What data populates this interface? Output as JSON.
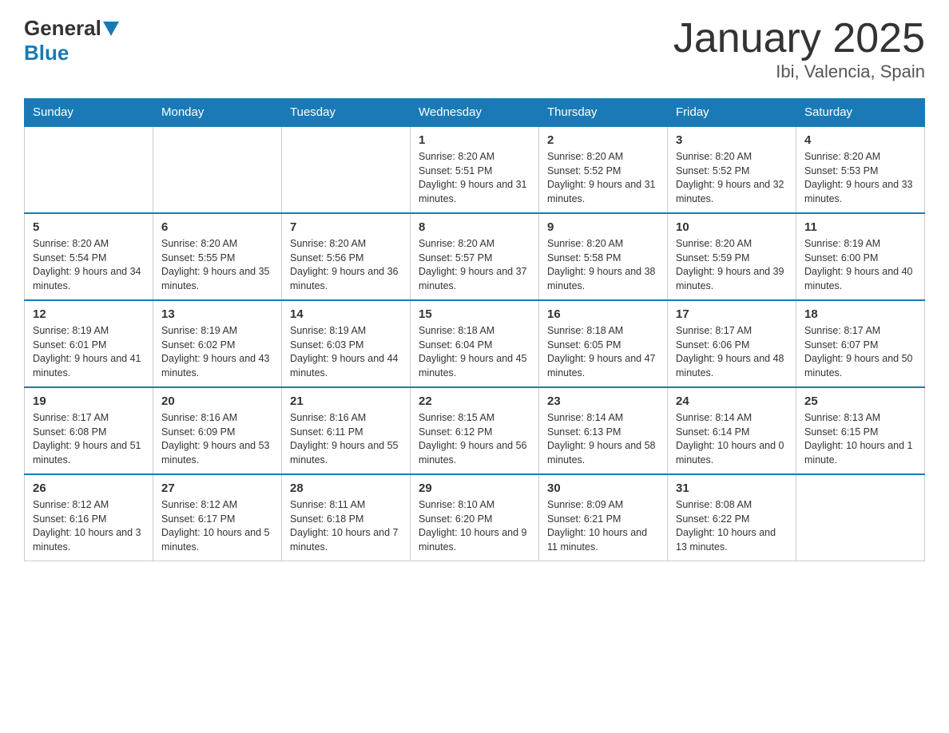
{
  "logo": {
    "general": "General",
    "blue": "Blue"
  },
  "title": "January 2025",
  "subtitle": "Ibi, Valencia, Spain",
  "days_of_week": [
    "Sunday",
    "Monday",
    "Tuesday",
    "Wednesday",
    "Thursday",
    "Friday",
    "Saturday"
  ],
  "weeks": [
    [
      {
        "num": "",
        "info": ""
      },
      {
        "num": "",
        "info": ""
      },
      {
        "num": "",
        "info": ""
      },
      {
        "num": "1",
        "info": "Sunrise: 8:20 AM\nSunset: 5:51 PM\nDaylight: 9 hours and 31 minutes."
      },
      {
        "num": "2",
        "info": "Sunrise: 8:20 AM\nSunset: 5:52 PM\nDaylight: 9 hours and 31 minutes."
      },
      {
        "num": "3",
        "info": "Sunrise: 8:20 AM\nSunset: 5:52 PM\nDaylight: 9 hours and 32 minutes."
      },
      {
        "num": "4",
        "info": "Sunrise: 8:20 AM\nSunset: 5:53 PM\nDaylight: 9 hours and 33 minutes."
      }
    ],
    [
      {
        "num": "5",
        "info": "Sunrise: 8:20 AM\nSunset: 5:54 PM\nDaylight: 9 hours and 34 minutes."
      },
      {
        "num": "6",
        "info": "Sunrise: 8:20 AM\nSunset: 5:55 PM\nDaylight: 9 hours and 35 minutes."
      },
      {
        "num": "7",
        "info": "Sunrise: 8:20 AM\nSunset: 5:56 PM\nDaylight: 9 hours and 36 minutes."
      },
      {
        "num": "8",
        "info": "Sunrise: 8:20 AM\nSunset: 5:57 PM\nDaylight: 9 hours and 37 minutes."
      },
      {
        "num": "9",
        "info": "Sunrise: 8:20 AM\nSunset: 5:58 PM\nDaylight: 9 hours and 38 minutes."
      },
      {
        "num": "10",
        "info": "Sunrise: 8:20 AM\nSunset: 5:59 PM\nDaylight: 9 hours and 39 minutes."
      },
      {
        "num": "11",
        "info": "Sunrise: 8:19 AM\nSunset: 6:00 PM\nDaylight: 9 hours and 40 minutes."
      }
    ],
    [
      {
        "num": "12",
        "info": "Sunrise: 8:19 AM\nSunset: 6:01 PM\nDaylight: 9 hours and 41 minutes."
      },
      {
        "num": "13",
        "info": "Sunrise: 8:19 AM\nSunset: 6:02 PM\nDaylight: 9 hours and 43 minutes."
      },
      {
        "num": "14",
        "info": "Sunrise: 8:19 AM\nSunset: 6:03 PM\nDaylight: 9 hours and 44 minutes."
      },
      {
        "num": "15",
        "info": "Sunrise: 8:18 AM\nSunset: 6:04 PM\nDaylight: 9 hours and 45 minutes."
      },
      {
        "num": "16",
        "info": "Sunrise: 8:18 AM\nSunset: 6:05 PM\nDaylight: 9 hours and 47 minutes."
      },
      {
        "num": "17",
        "info": "Sunrise: 8:17 AM\nSunset: 6:06 PM\nDaylight: 9 hours and 48 minutes."
      },
      {
        "num": "18",
        "info": "Sunrise: 8:17 AM\nSunset: 6:07 PM\nDaylight: 9 hours and 50 minutes."
      }
    ],
    [
      {
        "num": "19",
        "info": "Sunrise: 8:17 AM\nSunset: 6:08 PM\nDaylight: 9 hours and 51 minutes."
      },
      {
        "num": "20",
        "info": "Sunrise: 8:16 AM\nSunset: 6:09 PM\nDaylight: 9 hours and 53 minutes."
      },
      {
        "num": "21",
        "info": "Sunrise: 8:16 AM\nSunset: 6:11 PM\nDaylight: 9 hours and 55 minutes."
      },
      {
        "num": "22",
        "info": "Sunrise: 8:15 AM\nSunset: 6:12 PM\nDaylight: 9 hours and 56 minutes."
      },
      {
        "num": "23",
        "info": "Sunrise: 8:14 AM\nSunset: 6:13 PM\nDaylight: 9 hours and 58 minutes."
      },
      {
        "num": "24",
        "info": "Sunrise: 8:14 AM\nSunset: 6:14 PM\nDaylight: 10 hours and 0 minutes."
      },
      {
        "num": "25",
        "info": "Sunrise: 8:13 AM\nSunset: 6:15 PM\nDaylight: 10 hours and 1 minute."
      }
    ],
    [
      {
        "num": "26",
        "info": "Sunrise: 8:12 AM\nSunset: 6:16 PM\nDaylight: 10 hours and 3 minutes."
      },
      {
        "num": "27",
        "info": "Sunrise: 8:12 AM\nSunset: 6:17 PM\nDaylight: 10 hours and 5 minutes."
      },
      {
        "num": "28",
        "info": "Sunrise: 8:11 AM\nSunset: 6:18 PM\nDaylight: 10 hours and 7 minutes."
      },
      {
        "num": "29",
        "info": "Sunrise: 8:10 AM\nSunset: 6:20 PM\nDaylight: 10 hours and 9 minutes."
      },
      {
        "num": "30",
        "info": "Sunrise: 8:09 AM\nSunset: 6:21 PM\nDaylight: 10 hours and 11 minutes."
      },
      {
        "num": "31",
        "info": "Sunrise: 8:08 AM\nSunset: 6:22 PM\nDaylight: 10 hours and 13 minutes."
      },
      {
        "num": "",
        "info": ""
      }
    ]
  ]
}
